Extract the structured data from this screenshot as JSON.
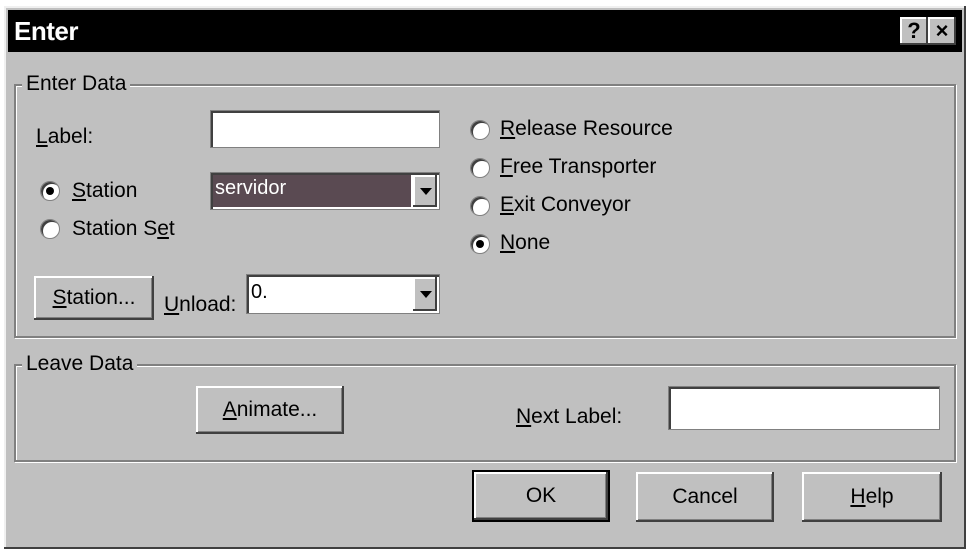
{
  "window": {
    "title": "Enter",
    "help_glyph": "?",
    "close_glyph": "×"
  },
  "enter_data": {
    "legend": "Enter Data",
    "label_caption_u": "L",
    "label_caption_rest": "abel:",
    "label_value": "",
    "station_radio_u": "S",
    "station_radio_rest": "tation",
    "stationset_radio_pre": "Station S",
    "stationset_radio_u": "e",
    "stationset_radio_rest": "t",
    "station_combo_value": "servidor",
    "station_button_u": "S",
    "station_button_rest": "tation...",
    "unload_caption_u": "U",
    "unload_caption_rest": "nload:",
    "unload_value": "0.",
    "options": [
      {
        "u": "R",
        "rest": "elease Resource",
        "checked": false
      },
      {
        "u": "F",
        "rest": "ree Transporter",
        "checked": false
      },
      {
        "u": "E",
        "rest": "xit Conveyor",
        "checked": false
      },
      {
        "u": "N",
        "rest": "one",
        "checked": true
      }
    ]
  },
  "leave_data": {
    "legend": "Leave Data",
    "animate_button_u": "A",
    "animate_button_rest": "nimate...",
    "next_label_u": "N",
    "next_label_rest": "ext Label:",
    "next_label_value": ""
  },
  "buttons": {
    "ok": "OK",
    "cancel": "Cancel",
    "help_u": "H",
    "help_rest": "elp"
  },
  "colors": {
    "face": "#c0c0c0",
    "titlebar": "#000000",
    "selection": "#5a4a52"
  }
}
